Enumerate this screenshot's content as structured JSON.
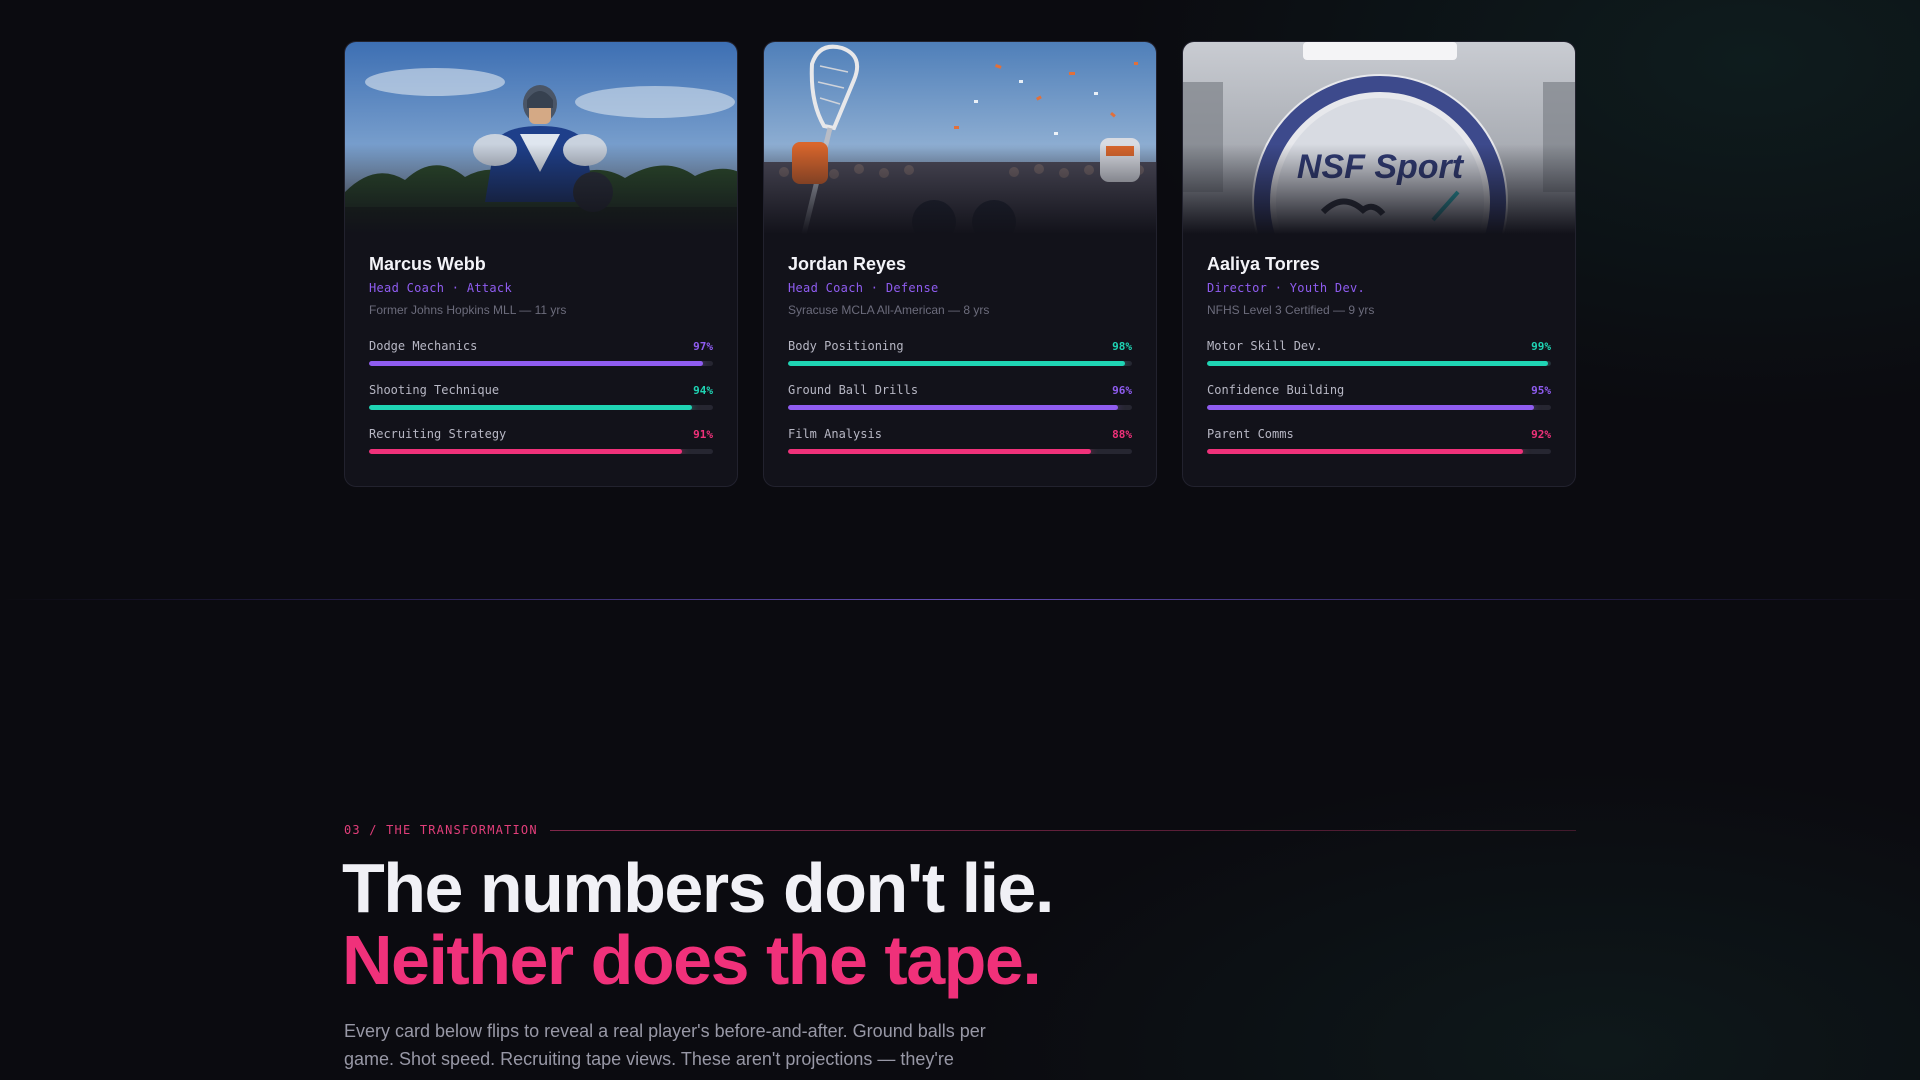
{
  "colors": {
    "purple": "#8f5cf0",
    "teal": "#1fd4b4",
    "pink": "#f0317a"
  },
  "coaches": [
    {
      "name": "Marcus Webb",
      "role": "Head Coach · Attack",
      "credential": "Former Johns Hopkins MLL — 11 yrs",
      "photo_icon": "lacrosse-player-photo",
      "skills": [
        {
          "name": "Dodge Mechanics",
          "pct_label": "97%",
          "value": 97,
          "color": "#8f5cf0"
        },
        {
          "name": "Shooting Technique",
          "pct_label": "94%",
          "value": 94,
          "color": "#1fd4b4"
        },
        {
          "name": "Recruiting Strategy",
          "pct_label": "91%",
          "value": 91,
          "color": "#f0317a"
        }
      ]
    },
    {
      "name": "Jordan Reyes",
      "role": "Head Coach · Defense",
      "credential": "Syracuse MCLA All-American — 8 yrs",
      "photo_icon": "lacrosse-stick-celebration-photo",
      "skills": [
        {
          "name": "Body Positioning",
          "pct_label": "98%",
          "value": 98,
          "color": "#1fd4b4"
        },
        {
          "name": "Ground Ball Drills",
          "pct_label": "96%",
          "value": 96,
          "color": "#8f5cf0"
        },
        {
          "name": "Film Analysis",
          "pct_label": "88%",
          "value": 88,
          "color": "#f0317a"
        }
      ]
    },
    {
      "name": "Aaliya Torres",
      "role": "Director · Youth Dev.",
      "credential": "NFHS Level 3 Certified — 9 yrs",
      "photo_icon": "nsf-sport-logo-photo",
      "logo_text": "NSF Sport",
      "skills": [
        {
          "name": "Motor Skill Dev.",
          "pct_label": "99%",
          "value": 99,
          "color": "#1fd4b4"
        },
        {
          "name": "Confidence Building",
          "pct_label": "95%",
          "value": 95,
          "color": "#8f5cf0"
        },
        {
          "name": "Parent Comms",
          "pct_label": "92%",
          "value": 92,
          "color": "#f0317a"
        }
      ]
    }
  ],
  "section": {
    "label": "03 / THE TRANSFORMATION",
    "headline_line1": "The numbers don't lie.",
    "headline_line2": "Neither does the tape.",
    "lede": "Every card below flips to reveal a real player's before-and-after. Ground balls per game. Shot speed. Recruiting tape views. These aren't projections — they're"
  }
}
